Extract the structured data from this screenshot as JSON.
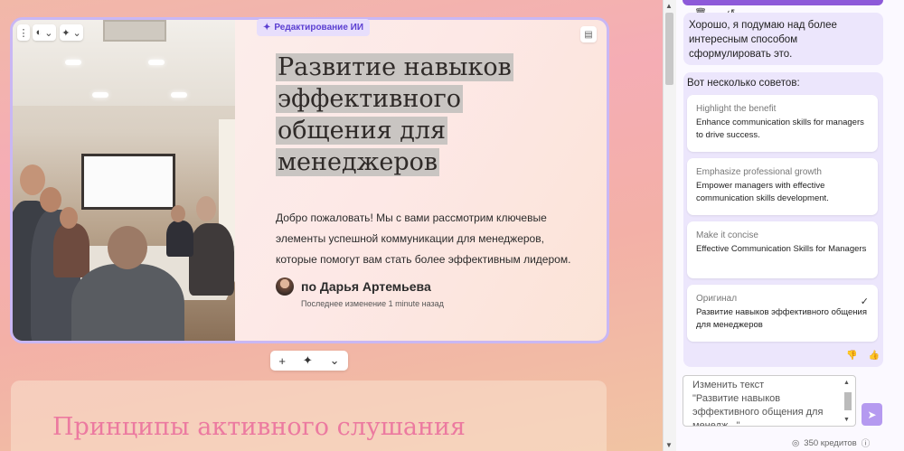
{
  "slide": {
    "ai_badge": "Редактирование ИИ",
    "title_lines": [
      "Развитие навыков",
      "эффективного",
      "общения для",
      "менеджеров"
    ],
    "lead": "Добро пожаловать! Мы с вами рассмотрим ключевые элементы успешной коммуникации для менеджеров, которые помогут вам стать более эффективным лидером.",
    "author": "по Дарья Артемьева",
    "last_edit": "Последнее изменение 1 minute назад"
  },
  "slide_actions": {
    "add": "+",
    "ai": "✦",
    "more": "⌄"
  },
  "next_slide": {
    "title": "Принципы активного слушания"
  },
  "panel": {
    "message": "Хорошо, я подумаю над более интересным способом сформулировать это.",
    "tips_heading": "Вот несколько советов:",
    "options": [
      {
        "caption": "Highlight the benefit",
        "text": "Enhance communication skills for managers to drive success.",
        "selected": false
      },
      {
        "caption": "Emphasize professional growth",
        "text": "Empower managers with effective communication skills development.",
        "selected": false
      },
      {
        "caption": "Make it concise",
        "text": "Effective Communication Skills for Managers",
        "selected": false
      },
      {
        "caption": "Оригинал",
        "text": "Развитие навыков эффективного общения для менеджеров",
        "selected": true
      }
    ],
    "input_text": "Изменить текст\n\"Развитие навыков эффективного общения для менедж...\"",
    "credits": "350 кредитов"
  },
  "colors": {
    "accent": "#8d5ad9",
    "ai_badge_text": "#5b3fd1",
    "next_title": "#ec7aa0"
  }
}
